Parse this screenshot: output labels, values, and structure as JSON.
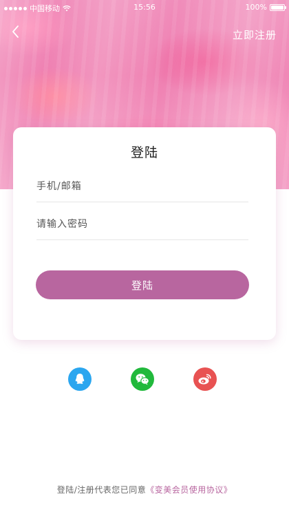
{
  "status_bar": {
    "carrier": "中国移动",
    "time": "15:56",
    "battery": "100%"
  },
  "nav": {
    "back_icon": "chevron-left-icon",
    "register_label": "立即注册"
  },
  "login_card": {
    "title": "登陆",
    "account_placeholder": "手机/邮箱",
    "password_placeholder": "请输入密码",
    "submit_label": "登陆"
  },
  "social": [
    {
      "name": "qq",
      "icon": "qq-icon",
      "color": "#2ba6ef"
    },
    {
      "name": "wechat",
      "icon": "wechat-icon",
      "color": "#21b93c"
    },
    {
      "name": "weibo",
      "icon": "weibo-icon",
      "color": "#e85252"
    }
  ],
  "agreement": {
    "prefix": "登陆/注册代表您已同意",
    "link_text": "《变美会员使用协议》"
  },
  "colors": {
    "accent": "#b8669f",
    "hero": "#ef86b6"
  }
}
